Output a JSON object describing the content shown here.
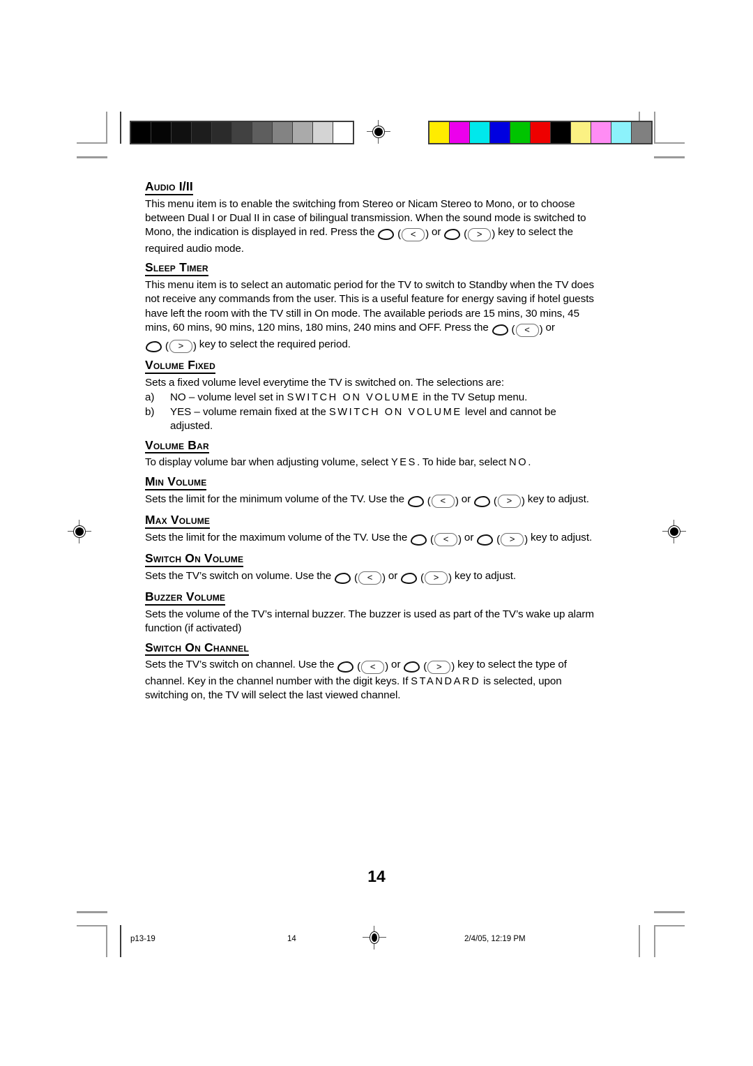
{
  "document": {
    "page_number": "14",
    "sections": [
      {
        "id": "audio-i-ii",
        "heading": "Audio I/II",
        "paragraphs": [
          {
            "runs": [
              {
                "type": "text",
                "text": "This menu item is to enable the switching from Stereo or Nicam Stereo to Mono, or to choose between Dual I or Dual II in case of bilingual transmission. When the sound mode is switched to Mono, the indication is displayed in red. Press the "
              },
              {
                "type": "key",
                "glyph": "<"
              },
              {
                "type": "text",
                "text": " or "
              },
              {
                "type": "key",
                "glyph": ">"
              },
              {
                "type": "text",
                "text": " key to select the required audio mode."
              }
            ]
          }
        ]
      },
      {
        "id": "sleep-timer",
        "heading": "Sleep Timer",
        "paragraphs": [
          {
            "runs": [
              {
                "type": "text",
                "text": "This menu item is to select an automatic period for the TV to switch to Standby when the TV does not receive any commands from the user. This is a useful feature for energy saving if hotel guests have left the room with the TV still in On mode. The available periods are 15 mins, 30 mins, 45 mins, 60 mins, 90 mins, 120 mins, 180 mins, 240 mins and OFF. Press the "
              },
              {
                "type": "key",
                "glyph": "<"
              },
              {
                "type": "text",
                "text": " or "
              },
              {
                "type": "key",
                "glyph": ">"
              },
              {
                "type": "text",
                "text": " key to select the required period."
              }
            ]
          }
        ]
      },
      {
        "id": "volume-fixed",
        "heading": "Volume Fixed",
        "paragraphs": [
          {
            "runs": [
              {
                "type": "text",
                "text": "Sets a fixed volume level everytime the TV is switched on. The selections are:"
              }
            ]
          }
        ],
        "choices": [
          {
            "marker": "a)",
            "runs": [
              {
                "type": "text",
                "text": "NO – volume level set in "
              },
              {
                "type": "menu",
                "text": "SWITCH ON VOLUME"
              },
              {
                "type": "text",
                "text": " in the TV Setup menu."
              }
            ]
          },
          {
            "marker": "b)",
            "runs": [
              {
                "type": "text",
                "text": "YES – volume remain fixed at the "
              },
              {
                "type": "menu",
                "text": "SWITCH ON VOLUME"
              },
              {
                "type": "text",
                "text": " level and cannot be adjusted."
              }
            ]
          }
        ]
      },
      {
        "id": "volume-bar",
        "heading": "Volume Bar",
        "paragraphs": [
          {
            "runs": [
              {
                "type": "text",
                "text": "To display volume bar when adjusting volume, select "
              },
              {
                "type": "menu",
                "text": "YES"
              },
              {
                "type": "text",
                "text": ". To hide bar, select "
              },
              {
                "type": "menu",
                "text": "NO"
              },
              {
                "type": "text",
                "text": "."
              }
            ]
          }
        ]
      },
      {
        "id": "min-volume",
        "heading": "Min Volume",
        "paragraphs": [
          {
            "runs": [
              {
                "type": "text",
                "text": "Sets the limit for the minimum volume of the TV. Use the "
              },
              {
                "type": "key",
                "glyph": "<"
              },
              {
                "type": "text",
                "text": " or "
              },
              {
                "type": "key",
                "glyph": ">"
              },
              {
                "type": "text",
                "text": " key to adjust."
              }
            ]
          }
        ]
      },
      {
        "id": "max-volume",
        "heading": "Max Volume",
        "paragraphs": [
          {
            "runs": [
              {
                "type": "text",
                "text": "Sets the limit for the maximum volume of the TV. Use the "
              },
              {
                "type": "key",
                "glyph": "<"
              },
              {
                "type": "text",
                "text": " or "
              },
              {
                "type": "key",
                "glyph": ">"
              },
              {
                "type": "text",
                "text": " key to adjust."
              }
            ]
          }
        ]
      },
      {
        "id": "switch-on-volume",
        "heading": "Switch On Volume",
        "paragraphs": [
          {
            "runs": [
              {
                "type": "text",
                "text": "Sets the TV’s switch on volume. Use the "
              },
              {
                "type": "key",
                "glyph": "<"
              },
              {
                "type": "text",
                "text": " or "
              },
              {
                "type": "key",
                "glyph": ">"
              },
              {
                "type": "text",
                "text": " key to adjust."
              }
            ]
          }
        ]
      },
      {
        "id": "buzzer-volume",
        "heading": "Buzzer Volume",
        "paragraphs": [
          {
            "runs": [
              {
                "type": "text",
                "text": "Sets the volume of the TV’s internal buzzer. The buzzer is used as part of the TV’s wake up alarm function (if activated)"
              }
            ]
          }
        ]
      },
      {
        "id": "switch-on-channel",
        "heading": "Switch On Channel",
        "paragraphs": [
          {
            "runs": [
              {
                "type": "text",
                "text": "Sets the TV’s switch on channel. Use the "
              },
              {
                "type": "key",
                "glyph": "<"
              },
              {
                "type": "text",
                "text": " or "
              },
              {
                "type": "key",
                "glyph": ">"
              },
              {
                "type": "text",
                "text": " key to select the type of channel. Key in the channel number with the digit keys. If "
              },
              {
                "type": "menu",
                "text": "STANDARD"
              },
              {
                "type": "text",
                "text": " is selected, upon switching on, the TV will select the last viewed channel."
              }
            ]
          }
        ]
      }
    ]
  },
  "footer": {
    "file_label": "p13-19",
    "page_label": "14",
    "timestamp": "2/4/05, 12:19 PM"
  },
  "print_marks": {
    "grayscale_bar": {
      "name": "grayscale-calibration-bar",
      "swatches": [
        "#000000",
        "#050505",
        "#101010",
        "#1d1d1d",
        "#2b2b2b",
        "#414141",
        "#5e5e5e",
        "#838383",
        "#aaaaaa",
        "#d4d4d4",
        "#ffffff"
      ]
    },
    "color_bar": {
      "name": "color-calibration-bar",
      "swatches": [
        "#ffec00",
        "#ec00ec",
        "#00e8ec",
        "#0000e0",
        "#00c400",
        "#ee0000",
        "#000000",
        "#fbf183",
        "#ff8cf4",
        "#8cf2fb",
        "#808080"
      ]
    }
  }
}
